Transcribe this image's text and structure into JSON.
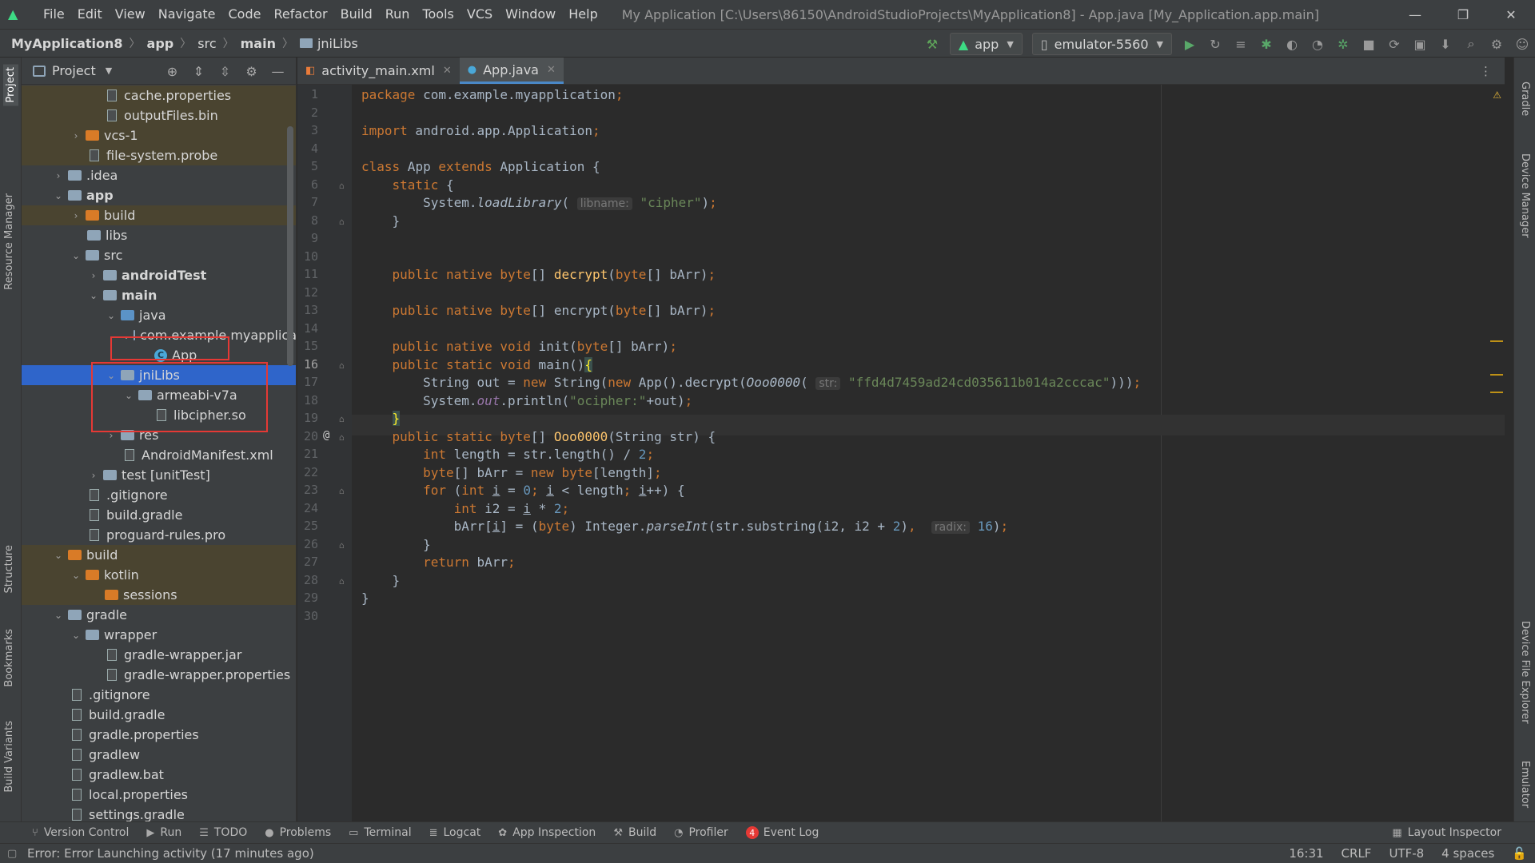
{
  "menubar": {
    "items": [
      "File",
      "Edit",
      "View",
      "Navigate",
      "Code",
      "Refactor",
      "Build",
      "Run",
      "Tools",
      "VCS",
      "Window",
      "Help"
    ],
    "window_title": "My Application [C:\\Users\\86150\\AndroidStudioProjects\\MyApplication8] - App.java [My_Application.app.main]"
  },
  "breadcrumbs": [
    "MyApplication8",
    "app",
    "src",
    "main",
    "jniLibs"
  ],
  "toolbar": {
    "run_config": "app",
    "device": "emulator-5560"
  },
  "left_strip": [
    "Project",
    "Resource Manager",
    "Structure",
    "Bookmarks",
    "Build Variants"
  ],
  "right_strip": [
    "Gradle",
    "Device Manager",
    "Device File Explorer",
    "Emulator"
  ],
  "project_panel": {
    "title": "Project",
    "tree": [
      {
        "label": "cache.properties",
        "icon": "properties-file-icon"
      },
      {
        "label": "outputFiles.bin",
        "icon": "file-icon"
      },
      {
        "label": "vcs-1",
        "icon": "folder-icon"
      },
      {
        "label": "file-system.probe",
        "icon": "file-icon"
      },
      {
        "label": ".idea",
        "icon": "folder-icon"
      },
      {
        "label": "app",
        "icon": "module-folder-icon"
      },
      {
        "label": "build",
        "icon": "folder-icon"
      },
      {
        "label": "libs",
        "icon": "folder-icon"
      },
      {
        "label": "src",
        "icon": "folder-icon"
      },
      {
        "label": "androidTest",
        "icon": "test-folder-icon"
      },
      {
        "label": "main",
        "icon": "folder-icon"
      },
      {
        "label": "java",
        "icon": "source-folder-icon"
      },
      {
        "label": "com.example.myapplica",
        "icon": "package-icon"
      },
      {
        "label": "App",
        "icon": "class-icon"
      },
      {
        "label": "jniLibs",
        "icon": "folder-icon"
      },
      {
        "label": "armeabi-v7a",
        "icon": "folder-icon"
      },
      {
        "label": "libcipher.so",
        "icon": "file-icon"
      },
      {
        "label": "res",
        "icon": "folder-icon"
      },
      {
        "label": "AndroidManifest.xml",
        "icon": "manifest-icon"
      },
      {
        "label": "test [unitTest]",
        "icon": "test-folder-icon"
      },
      {
        "label": ".gitignore",
        "icon": "file-icon"
      },
      {
        "label": "build.gradle",
        "icon": "gradle-icon"
      },
      {
        "label": "proguard-rules.pro",
        "icon": "file-icon"
      },
      {
        "label": "build",
        "icon": "folder-icon"
      },
      {
        "label": "kotlin",
        "icon": "folder-icon"
      },
      {
        "label": "sessions",
        "icon": "folder-icon"
      },
      {
        "label": "gradle",
        "icon": "folder-icon"
      },
      {
        "label": "wrapper",
        "icon": "folder-icon"
      },
      {
        "label": "gradle-wrapper.jar",
        "icon": "jar-icon"
      },
      {
        "label": "gradle-wrapper.properties",
        "icon": "properties-file-icon"
      },
      {
        "label": ".gitignore",
        "icon": "file-icon"
      },
      {
        "label": "build.gradle",
        "icon": "gradle-icon"
      },
      {
        "label": "gradle.properties",
        "icon": "properties-file-icon"
      },
      {
        "label": "gradlew",
        "icon": "file-icon"
      },
      {
        "label": "gradlew.bat",
        "icon": "file-icon"
      },
      {
        "label": "local.properties",
        "icon": "properties-file-icon"
      },
      {
        "label": "settings.gradle",
        "icon": "gradle-icon"
      }
    ]
  },
  "editor": {
    "tabs": [
      {
        "label": "activity_main.xml",
        "active": false
      },
      {
        "label": "App.java",
        "active": true
      }
    ],
    "line_numbers": [
      "1",
      "2",
      "3",
      "4",
      "5",
      "6",
      "7",
      "8",
      "9",
      "10",
      "11",
      "12",
      "13",
      "14",
      "15",
      "16",
      "17",
      "18",
      "19",
      "20",
      "21",
      "22",
      "23",
      "24",
      "25",
      "26",
      "27",
      "28",
      "29",
      "30"
    ],
    "current_line": "16",
    "hints": {
      "libname": "libname:",
      "str": "str:",
      "radix": "radix:"
    },
    "strings": {
      "cipher": "\"cipher\"",
      "hex": "\"ffd4d7459ad24cd035611b014a2cccac\"",
      "ocipher": "\"ocipher:\""
    }
  },
  "bottom_tools": [
    {
      "label": "Version Control",
      "icon": "branch-icon"
    },
    {
      "label": "Run",
      "icon": "run-icon"
    },
    {
      "label": "TODO",
      "icon": "list-icon"
    },
    {
      "label": "Problems",
      "icon": "problems-icon"
    },
    {
      "label": "Terminal",
      "icon": "terminal-icon"
    },
    {
      "label": "Logcat",
      "icon": "logcat-icon"
    },
    {
      "label": "App Inspection",
      "icon": "inspection-icon"
    },
    {
      "label": "Build",
      "icon": "hammer-icon"
    },
    {
      "label": "Profiler",
      "icon": "profiler-icon"
    },
    {
      "label": "Event Log",
      "icon": "event-log-icon",
      "badge": "4"
    }
  ],
  "layout_inspector": "Layout Inspector",
  "status": {
    "message": "Error: Error Launching activity (17 minutes ago)",
    "position": "16:31",
    "line_sep": "CRLF",
    "encoding": "UTF-8",
    "indent": "4 spaces"
  },
  "colors": {
    "selection": "#2f65ca",
    "annotation_box": "#e53935",
    "keyword": "#cc7832",
    "string": "#6a8759",
    "number": "#6897bb",
    "method": "#ffc66d"
  }
}
